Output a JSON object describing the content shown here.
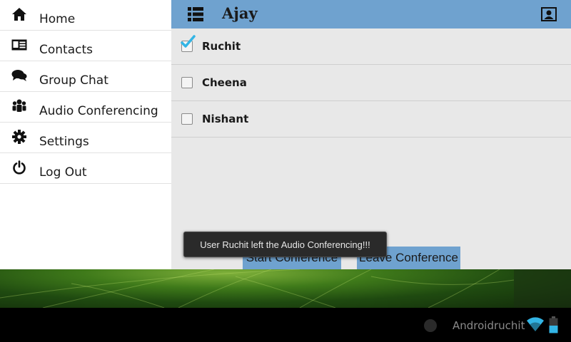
{
  "drawer": {
    "items": [
      {
        "label": "Home",
        "icon": "home-icon"
      },
      {
        "label": "Contacts",
        "icon": "contact-card-icon"
      },
      {
        "label": "Group Chat",
        "icon": "chat-bubbles-icon"
      },
      {
        "label": "Audio Conferencing",
        "icon": "group-icon"
      },
      {
        "label": "Settings",
        "icon": "gear-icon"
      },
      {
        "label": "Log Out",
        "icon": "power-icon"
      }
    ]
  },
  "actionbar": {
    "title": "Ajay",
    "color": "#6fa2cf",
    "menu_icon": "list-menu-icon",
    "profile_icon": "profile-card-icon"
  },
  "users": [
    {
      "name": "Ruchit",
      "checked": true
    },
    {
      "name": "Cheena",
      "checked": false
    },
    {
      "name": "Nishant",
      "checked": false
    }
  ],
  "buttons": {
    "start_label": "Start Conference",
    "leave_label": "Leave Conference"
  },
  "toast": {
    "message": "User Ruchit left the Audio Conferencing!!!"
  },
  "statusbar": {
    "carrier": "Androidruchit",
    "wifi_icon": "wifi-icon",
    "battery_icon": "battery-icon",
    "wifi_color": "#33b5e5"
  }
}
